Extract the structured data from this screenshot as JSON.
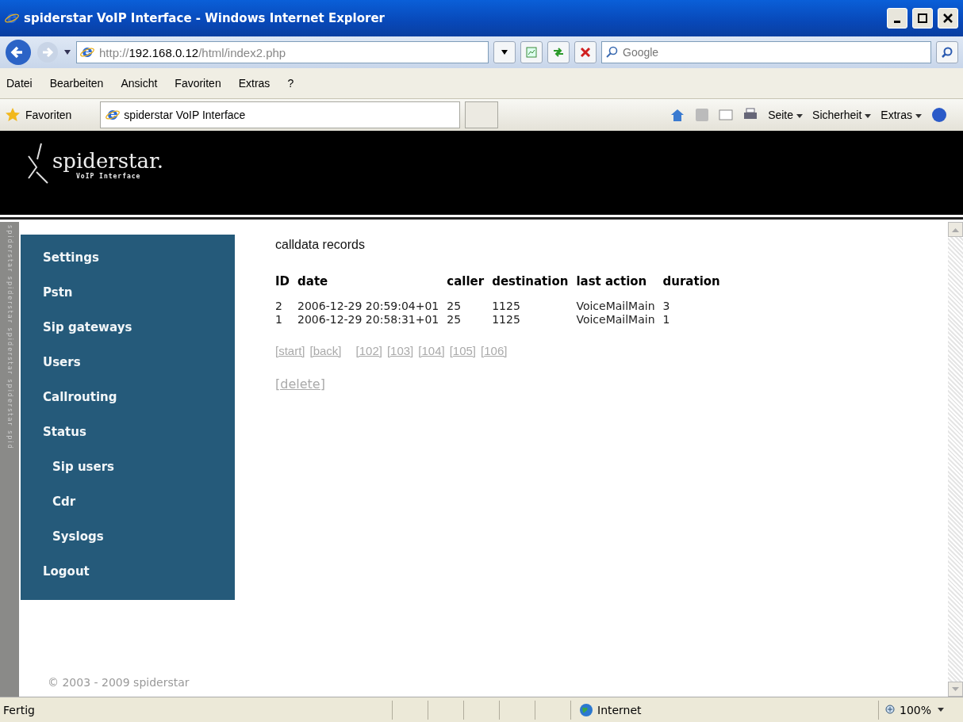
{
  "window": {
    "title": "spiderstar VoIP Interface - Windows Internet Explorer"
  },
  "address_bar": {
    "scheme": "http://",
    "host": "192.168.0.12",
    "path": "/html/index2.php"
  },
  "search": {
    "placeholder": "Google"
  },
  "menu": [
    "Datei",
    "Bearbeiten",
    "Ansicht",
    "Favoriten",
    "Extras",
    "?"
  ],
  "favorites_bar": {
    "favorites": "Favoriten",
    "tab": "spiderstar VoIP Interface",
    "tools": [
      "Seite",
      "Sicherheit",
      "Extras"
    ]
  },
  "site": {
    "logo": "spiderstar.",
    "logo_sub": "VoIP Interface",
    "strip_text": "spiderstar spiderstar spiderstar spiderstar spid"
  },
  "nav": [
    {
      "label": "Settings"
    },
    {
      "label": "Pstn"
    },
    {
      "label": "Sip gateways"
    },
    {
      "label": "Users"
    },
    {
      "label": "Callrouting"
    },
    {
      "label": "Status",
      "children": [
        {
          "label": "Sip users"
        },
        {
          "label": "Cdr"
        },
        {
          "label": "Syslogs"
        }
      ]
    },
    {
      "label": "Logout"
    }
  ],
  "page_title": "calldata records",
  "table": {
    "columns": [
      "ID",
      "date",
      "caller",
      "destination",
      "last action",
      "duration"
    ],
    "rows": [
      [
        "2",
        "2006-12-29 20:59:04+01",
        "25",
        "1125",
        "VoiceMailMain",
        "3"
      ],
      [
        "1",
        "2006-12-29 20:58:31+01",
        "25",
        "1125",
        "VoiceMailMain",
        "1"
      ]
    ]
  },
  "pager": [
    "[start]",
    "[back]",
    "[102]",
    "[103]",
    "[104]",
    "[105]",
    "[106]"
  ],
  "delete_link": "[delete]",
  "copyright": "© 2003 - 2009 spiderstar",
  "status_bar": {
    "text": "Fertig",
    "zone": "Internet",
    "zoom": "100%"
  }
}
